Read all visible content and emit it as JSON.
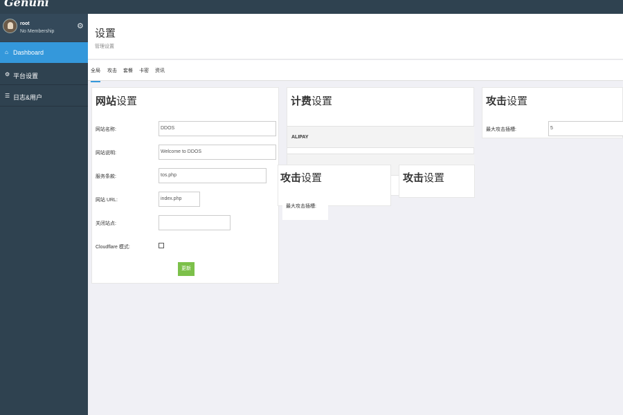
{
  "app": {
    "logo": "Genuni"
  },
  "user": {
    "name": "root",
    "membership": "No Membership"
  },
  "icons": {
    "settings": "gear-icon",
    "home": "home-icon",
    "cogs": "cogs-icon",
    "list": "list-icon",
    "avatar": "avatar-icon"
  },
  "colors": {
    "sidebar": "#2f4250",
    "active_nav": "#3498db",
    "update_button": "#7cc04a"
  },
  "sidebar": {
    "items": [
      {
        "label": "Dashboard",
        "icon": "home-icon",
        "active": true
      },
      {
        "label": "平台设置",
        "icon": "cogs-icon",
        "active": false
      },
      {
        "label": "日志&用户",
        "icon": "list-icon",
        "active": false
      }
    ]
  },
  "header": {
    "title": "设置",
    "subtitle": "管理设置"
  },
  "tabs": [
    {
      "label": "全局",
      "active": true
    },
    {
      "label": "攻击",
      "active": false
    },
    {
      "label": "套餐",
      "active": false
    },
    {
      "label": "卡密",
      "active": false
    },
    {
      "label": "资讯",
      "active": false
    }
  ],
  "website_card": {
    "title_bold": "网站",
    "title_rest": "设置",
    "fields": [
      {
        "label": "网站名称:",
        "value": "DDOS"
      },
      {
        "label": "网站说明:",
        "value": "Welcome to DDOS"
      },
      {
        "label": "服务条款:",
        "value": "tos.php"
      },
      {
        "label": "网站 URL:",
        "value": "index.php"
      },
      {
        "label": "关闭站点:",
        "value": ""
      }
    ],
    "cloudflare_label": "Cloudflare 模式:",
    "cloudflare_checked": false,
    "update_label": "更新"
  },
  "billing_card": {
    "title_bold": "计费",
    "title_rest": "设置",
    "row1": "ALIPAY"
  },
  "attack_card": {
    "title_bold": "攻击",
    "title_rest": "设置",
    "label": "最大攻击插槽:",
    "value": "5"
  },
  "attack_card_2": {
    "title_bold": "攻击",
    "title_rest": "设置",
    "label": "最大攻击插槽:"
  },
  "attack_card_3": {
    "title_bold": "攻击",
    "title_rest": "设置"
  }
}
